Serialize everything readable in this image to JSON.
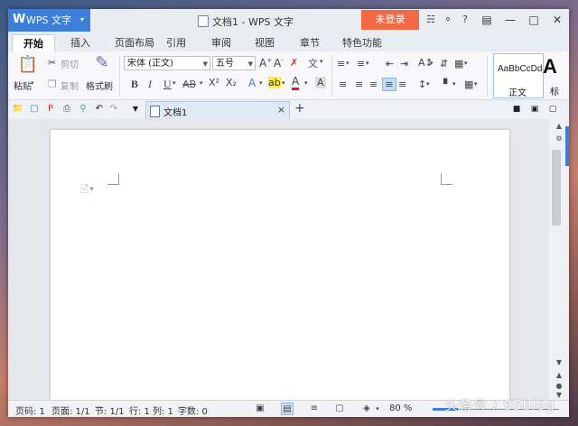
{
  "titlebar": {
    "app_logo": "W",
    "app_name": "WPS 文字",
    "app_caret": "▾",
    "document_title": "文档1 - WPS 文字",
    "login_label": "未登录",
    "icons": [
      "shirt-icon",
      "chat-icon",
      "help-icon",
      "restore-app-icon",
      "minimize-icon",
      "maximize-icon",
      "close-icon"
    ]
  },
  "tabs": [
    {
      "label": "开始",
      "active": true
    },
    {
      "label": "插入"
    },
    {
      "label": "页面布局"
    },
    {
      "label": "引用"
    },
    {
      "label": "审阅"
    },
    {
      "label": "视图"
    },
    {
      "label": "章节"
    },
    {
      "label": "特色功能"
    }
  ],
  "ribbon": {
    "cut_label": "剪切",
    "copy_label": "复制",
    "paste_label": "粘贴",
    "format_painter_label": "格式刷",
    "font_name": "宋体 (正文)",
    "font_size": "五号",
    "bold": "B",
    "italic": "I",
    "underline": "U",
    "strike": "AB",
    "superscript": "X²",
    "subscript": "X₂",
    "style_preview": "AaBbCcDd",
    "style_name": "正文",
    "big_style_letter": "A",
    "big_style_label": "标"
  },
  "quickbar": {
    "document_tab": "文档1",
    "close_glyph": "×",
    "new_tab_glyph": "+"
  },
  "statusbar": {
    "page_no": "页码: 1",
    "pages": "页面: 1/1",
    "section": "节: 1/1",
    "row": "行: 1",
    "col": "列: 1",
    "wordcount": "字数: 0",
    "zoom": "80 %",
    "zoom_fraction": 0.2
  },
  "watermark": "头条号 / 95blog",
  "colors": {
    "accent": "#3d7fd8",
    "login": "#f16a45"
  }
}
